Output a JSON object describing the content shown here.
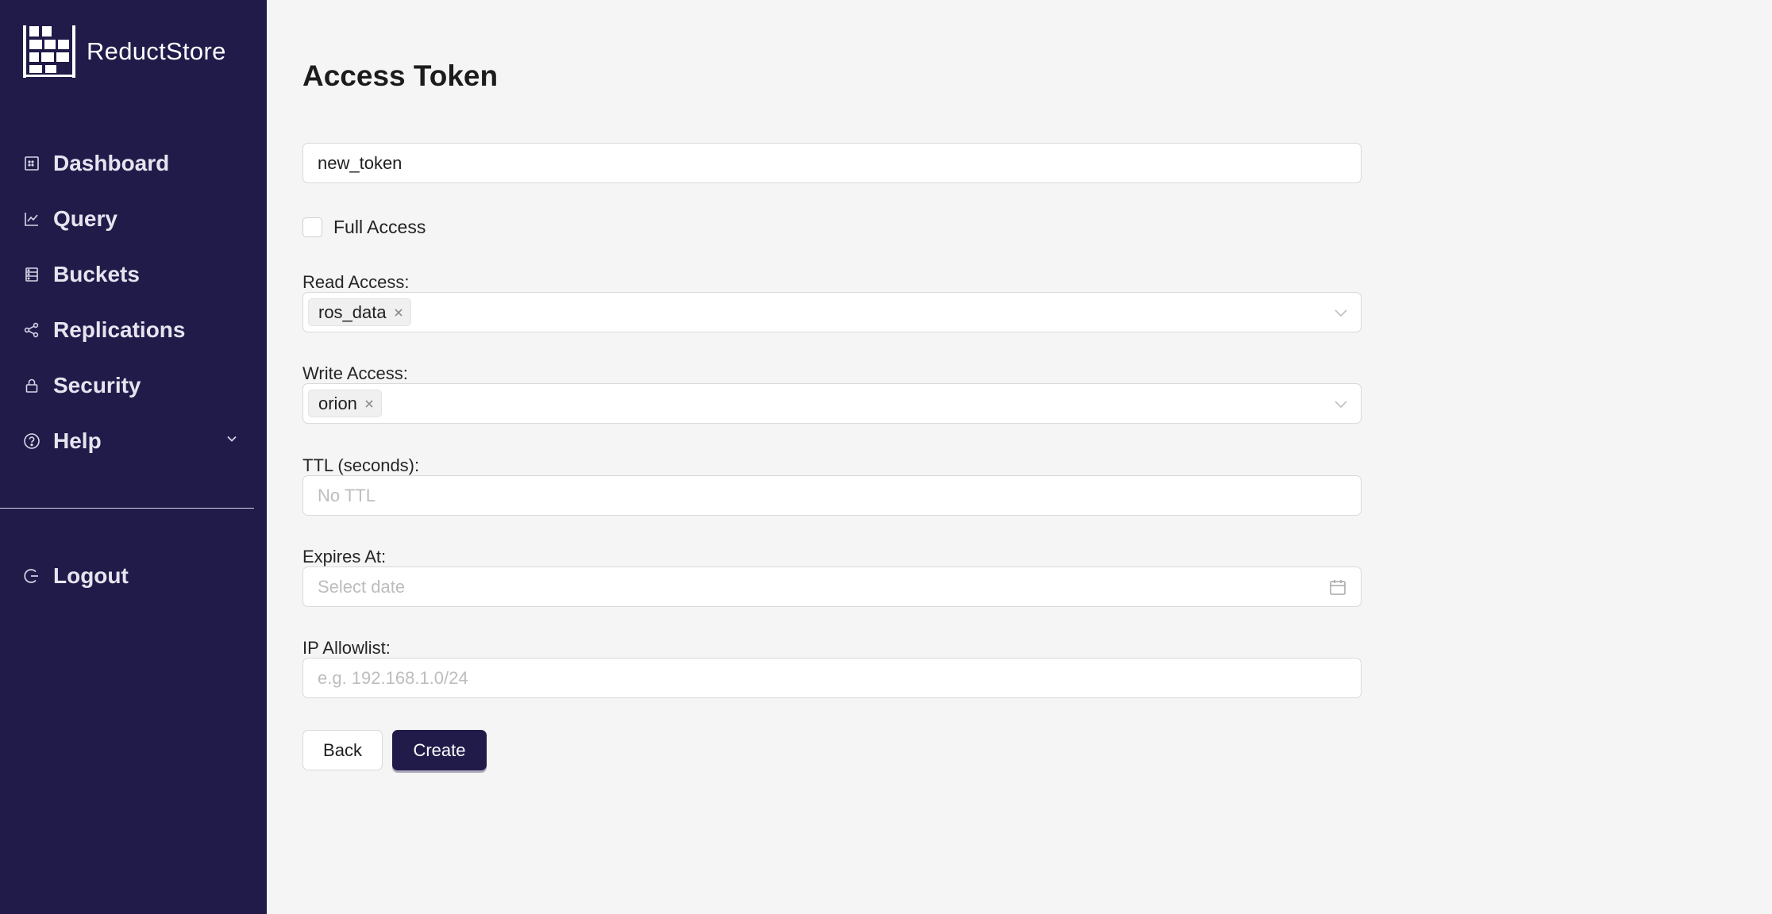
{
  "app": {
    "name": "ReductStore"
  },
  "colors": {
    "sidebar_bg": "#211b4a",
    "accent": "#211b4a",
    "page_bg": "#f5f5f5"
  },
  "sidebar": {
    "items": [
      {
        "label": "Dashboard",
        "icon": "dashboard-icon"
      },
      {
        "label": "Query",
        "icon": "line-chart-icon"
      },
      {
        "label": "Buckets",
        "icon": "database-icon"
      },
      {
        "label": "Replications",
        "icon": "share-icon"
      },
      {
        "label": "Security",
        "icon": "lock-icon"
      },
      {
        "label": "Help",
        "icon": "question-circle-icon",
        "expandable": true
      }
    ],
    "logout": {
      "label": "Logout",
      "icon": "logout-icon"
    }
  },
  "form": {
    "title": "Access Token",
    "name_value": "new_token",
    "full_access": {
      "label": "Full Access",
      "checked": false
    },
    "read_access": {
      "label": "Read Access:",
      "tags": [
        "ros_data"
      ]
    },
    "write_access": {
      "label": "Write Access:",
      "tags": [
        "orion"
      ]
    },
    "ttl": {
      "label": "TTL (seconds):",
      "placeholder": "No TTL",
      "value": ""
    },
    "expires_at": {
      "label": "Expires At:",
      "placeholder": "Select date",
      "value": ""
    },
    "ip_allowlist": {
      "label": "IP Allowlist:",
      "placeholder": "e.g. 192.168.1.0/24",
      "value": ""
    },
    "buttons": {
      "back": "Back",
      "create": "Create"
    }
  }
}
